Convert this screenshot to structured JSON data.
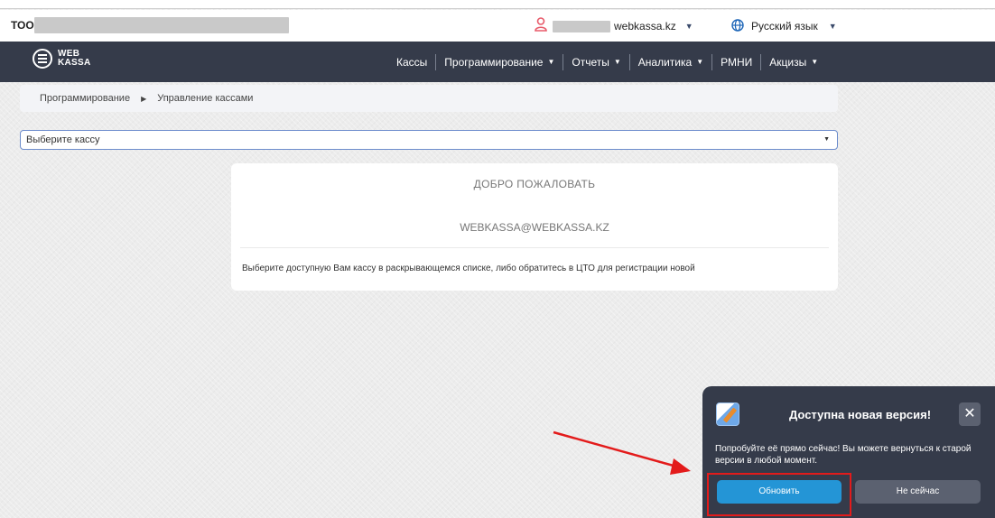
{
  "top_bar": {
    "org_prefix": "ТОО",
    "user_email_domain": "webkassa.kz",
    "user_caret": "▼",
    "language": "Русский язык",
    "language_caret": "▼"
  },
  "navbar": {
    "logo_line1": "WEB",
    "logo_line2": "KASSA",
    "items": [
      {
        "label": "Кассы",
        "has_caret": false
      },
      {
        "label": "Программирование",
        "has_caret": true
      },
      {
        "label": "Отчеты",
        "has_caret": true
      },
      {
        "label": "Аналитика",
        "has_caret": true
      },
      {
        "label": "РМНИ",
        "has_caret": false
      },
      {
        "label": "Акцизы",
        "has_caret": true
      }
    ],
    "caret": "▼"
  },
  "breadcrumb": {
    "parent": "Программирование",
    "separator": "▶",
    "current": "Управление кассами"
  },
  "kassa_select": {
    "value": "Выберите кассу",
    "caret": "▼"
  },
  "welcome_card": {
    "title": "ДОБРО ПОЖАЛОВАТЬ",
    "email": "WEBKASSA@WEBKASSA.KZ",
    "hint": "Выберите доступную Вам кассу в раскрывающемся списке, либо обратитесь в ЦТО для регистрации новой"
  },
  "update_popup": {
    "title": "Доступна новая версия!",
    "close": "✕",
    "text": "Попробуйте её прямо сейчас! Вы можете вернуться к старой версии в любой момент.",
    "update_button": "Обновить",
    "later_button": "Не сейчас"
  },
  "colors": {
    "navbar_bg": "#353b4a",
    "update_button": "#2495d6",
    "highlight": "#e31b1b",
    "user_icon": "#e85a6a",
    "globe_icon": "#1e66b8"
  },
  "icons": [
    "user-icon",
    "globe-icon",
    "webkassa-logo-icon",
    "update-app-icon",
    "close-icon"
  ]
}
